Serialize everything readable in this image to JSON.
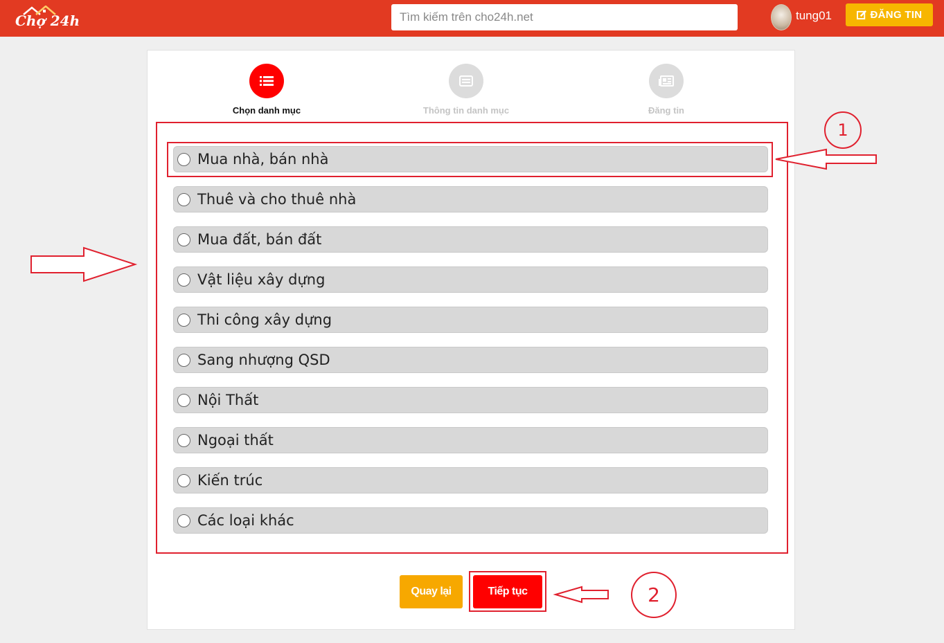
{
  "header": {
    "logo_text": "Chợ 24h",
    "search_placeholder": "Tìm kiếm trên cho24h.net",
    "username": "tung01",
    "post_button": "ĐĂNG TIN"
  },
  "steps": [
    {
      "label": "Chọn danh mục",
      "state": "active"
    },
    {
      "label": "Thông tin danh mục",
      "state": "inactive"
    },
    {
      "label": "Đăng tin",
      "state": "inactive"
    }
  ],
  "categories": [
    "Mua nhà, bán nhà",
    "Thuê và cho thuê nhà",
    "Mua đất, bán đất",
    "Vật liệu xây dựng",
    "Thi công xây dựng",
    "Sang nhượng QSD",
    "Nội Thất",
    "Ngoại thất",
    "Kiến trúc",
    "Các loại khác"
  ],
  "buttons": {
    "back": "Quay lại",
    "next": "Tiếp tục"
  },
  "annotations": {
    "marker_1": "1",
    "marker_2": "2"
  },
  "colors": {
    "brand": "#e23a22",
    "accent": "#f7b600",
    "active_step": "#ff0000",
    "annotation": "#e0202e"
  }
}
